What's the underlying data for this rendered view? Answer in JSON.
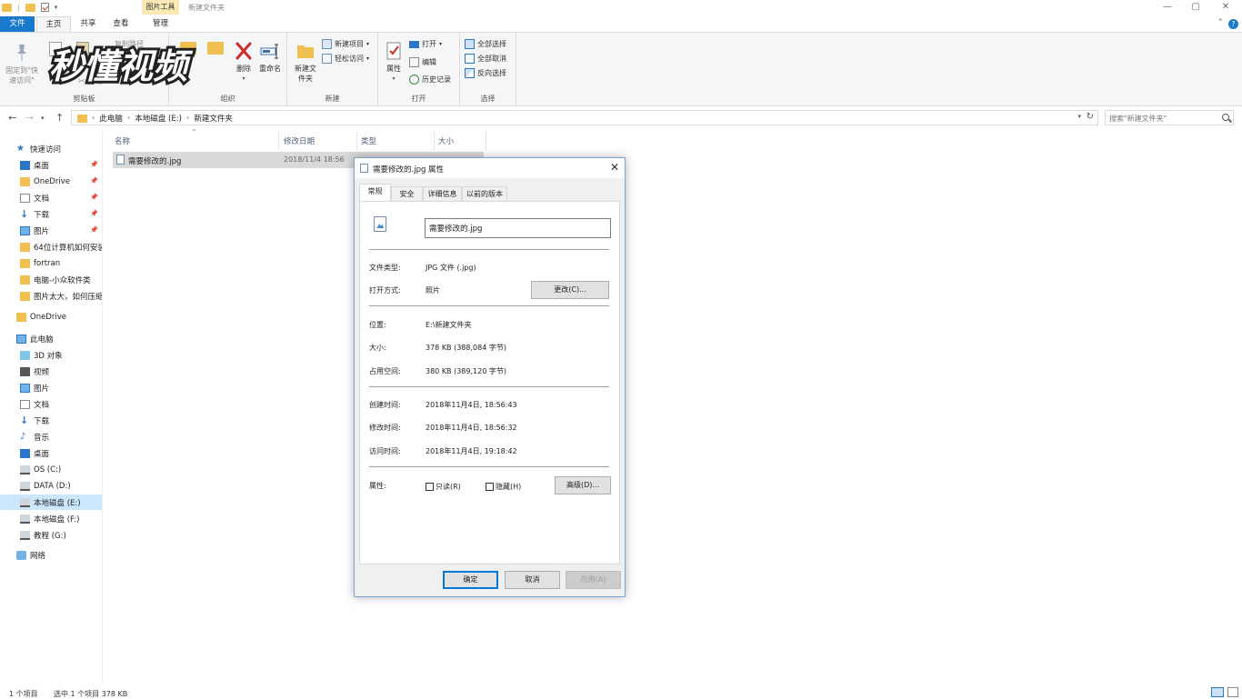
{
  "titlebar": {
    "context_tab": "图片工具",
    "window_title": "新建文件夹",
    "minimize": "—",
    "maximize": "▢",
    "close": "✕"
  },
  "tabs": {
    "file": "文件",
    "home": "主页",
    "share": "共享",
    "view": "查看",
    "manage": "管理"
  },
  "ribbon": {
    "clipboard": {
      "label": "剪贴板",
      "pin_quick_access": "固定到\"快速访问\"",
      "copy_path": "复制路径",
      "cut": "剪切"
    },
    "organize": {
      "label": "组织",
      "delete": "删除",
      "rename": "重命名"
    },
    "new": {
      "label": "新建",
      "new_folder": "新建文件夹",
      "new_item": "新建项目",
      "easy_access": "轻松访问"
    },
    "open": {
      "label": "打开",
      "properties": "属性",
      "open": "打开",
      "edit": "编辑",
      "history": "历史记录"
    },
    "select": {
      "label": "选择",
      "select_all": "全部选择",
      "select_none": "全部取消",
      "invert": "反向选择"
    }
  },
  "watermark": "秒懂视频",
  "address": {
    "crumbs": [
      "此电脑",
      "本地磁盘 (E:)",
      "新建文件夹"
    ],
    "search_placeholder": "搜索\"新建文件夹\""
  },
  "nav": {
    "quick_access": "快速访问",
    "quick_items": [
      "桌面",
      "OneDrive",
      "文档",
      "下载",
      "图片",
      "64位计算机如何安装",
      "fortran",
      "电脑-小众软件类",
      "图片太大，如何压缩"
    ],
    "onedrive": "OneDrive",
    "this_pc": "此电脑",
    "pc_items": [
      "3D 对象",
      "视频",
      "图片",
      "文档",
      "下载",
      "音乐",
      "桌面",
      "OS (C:)",
      "DATA (D:)",
      "本地磁盘 (E:)",
      "本地磁盘 (F:)",
      "教程 (G:)"
    ],
    "network": "网络"
  },
  "filelist": {
    "columns": [
      "名称",
      "修改日期",
      "类型",
      "大小"
    ],
    "rows": [
      {
        "name": "需要修改的.jpg",
        "date": "2018/11/4 18:56"
      }
    ]
  },
  "status": {
    "count": "1 个项目",
    "selected": "选中 1 个项目  378 KB"
  },
  "dialog": {
    "title": "需要修改的.jpg 属性",
    "tabs": [
      "常规",
      "安全",
      "详细信息",
      "以前的版本"
    ],
    "file_name": "需要修改的.jpg",
    "file_type_label": "文件类型:",
    "file_type": "JPG 文件 (.jpg)",
    "open_with_label": "打开方式:",
    "open_with": "照片",
    "change_button": "更改(C)...",
    "location_label": "位置:",
    "location": "E:\\新建文件夹",
    "size_label": "大小:",
    "size": "378 KB (388,084 字节)",
    "disk_size_label": "占用空间:",
    "disk_size": "380 KB (389,120 字节)",
    "created_label": "创建时间:",
    "created": "2018年11月4日, 18:56:43",
    "modified_label": "修改时间:",
    "modified": "2018年11月4日, 18:56:32",
    "accessed_label": "访问时间:",
    "accessed": "2018年11月4日, 19:18:42",
    "attributes_label": "属性:",
    "readonly": "只读(R)",
    "hidden": "隐藏(H)",
    "advanced_button": "高级(D)...",
    "ok": "确定",
    "cancel": "取消",
    "apply": "应用(A)"
  }
}
